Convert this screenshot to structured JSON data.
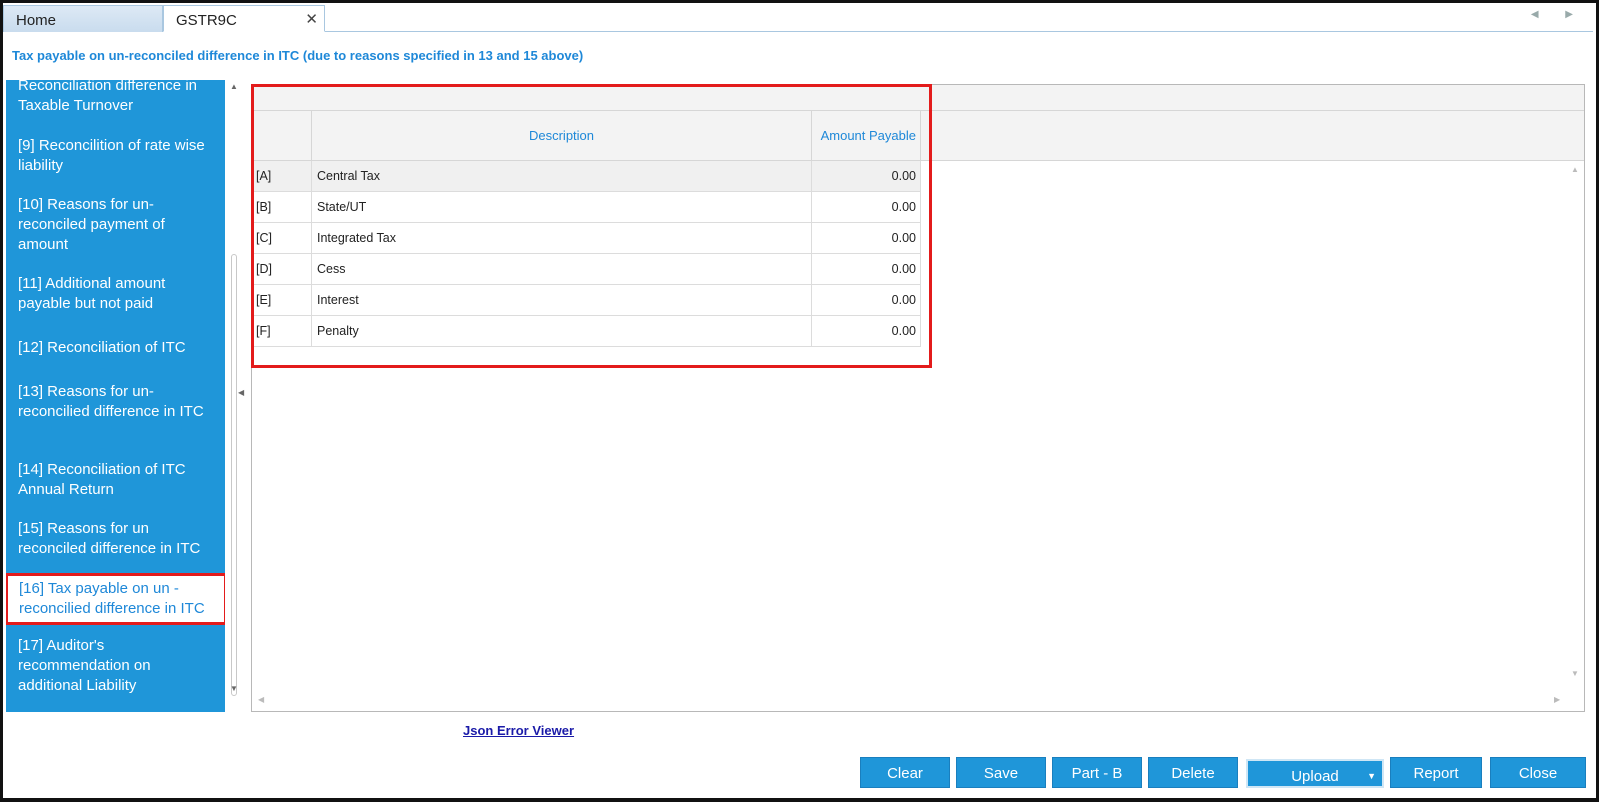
{
  "tabs": {
    "home": "Home",
    "gstr": "GSTR9C",
    "close_glyph": "✕",
    "scroll_arrows": "◀ ▶"
  },
  "section_heading": "Tax payable on un-reconciled difference in ITC (due to reasons specified in 13 and 15 above)",
  "sidebar": {
    "items": [
      {
        "label": "Reconciliation difference in Taxable Turnover"
      },
      {
        "label": "[9] Reconcilition of rate wise liability"
      },
      {
        "label": "[10] Reasons for un-reconciled payment of amount"
      },
      {
        "label": "[11] Additional amount payable but not paid"
      },
      {
        "label": "[12] Reconciliation of ITC"
      },
      {
        "label": "[13] Reasons for un-reconcilied difference in ITC"
      },
      {
        "label": "[14] Reconciliation of ITC Annual Return"
      },
      {
        "label": "[15] Reasons for un reconciled difference in ITC"
      },
      {
        "label": "[16] Tax payable on un - reconcilied difference in ITC",
        "selected": true
      },
      {
        "label": "[17] Auditor's recommendation on additional Liability"
      }
    ]
  },
  "grid": {
    "columns": {
      "code": "",
      "description": "Description",
      "amount": "Amount Payable"
    },
    "rows": [
      {
        "code": "[A]",
        "description": "Central Tax",
        "amount": "0.00"
      },
      {
        "code": "[B]",
        "description": "State/UT",
        "amount": "0.00"
      },
      {
        "code": "[C]",
        "description": "Integrated Tax",
        "amount": "0.00"
      },
      {
        "code": "[D]",
        "description": "Cess",
        "amount": "0.00"
      },
      {
        "code": "[E]",
        "description": "Interest",
        "amount": "0.00"
      },
      {
        "code": "[F]",
        "description": "Penalty",
        "amount": "0.00"
      }
    ]
  },
  "links": {
    "json_error_viewer": "Json Error Viewer"
  },
  "buttons": {
    "clear": "Clear",
    "save": "Save",
    "part_b": "Part - B",
    "delete": "Delete",
    "upload": "Upload",
    "report": "Report",
    "close": "Close"
  },
  "colors": {
    "accent": "#1f96d9",
    "heading_text": "#1e88d8",
    "highlight": "#e31b1b"
  }
}
